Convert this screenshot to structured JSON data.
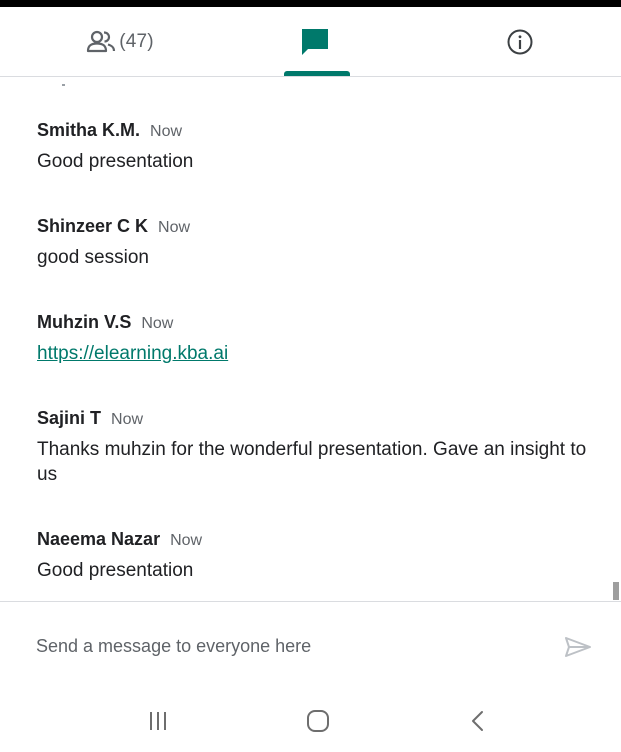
{
  "tabs": {
    "people_count": "(47)",
    "active": "chat"
  },
  "messages": [
    {
      "sender": "Smitha K.M.",
      "time": "Now",
      "text": "Good presentation",
      "is_link": false
    },
    {
      "sender": "Shinzeer C K",
      "time": "Now",
      "text": "good session",
      "is_link": false
    },
    {
      "sender": "Muhzin V.S",
      "time": "Now",
      "text": "https://elearning.kba.ai",
      "is_link": true
    },
    {
      "sender": "Sajini T",
      "time": "Now",
      "text": "Thanks muhzin for the wonderful presentation. Gave an insight to us",
      "is_link": false
    },
    {
      "sender": "Naeema Nazar",
      "time": "Now",
      "text": "Good presentation",
      "is_link": false
    }
  ],
  "composer": {
    "placeholder": "Send a message to everyone here",
    "value": ""
  },
  "icons": {
    "people": "people-icon",
    "chat": "chat-bubble-icon",
    "info": "info-icon",
    "send": "send-icon",
    "recents": "recents-icon",
    "home": "home-icon",
    "back": "back-icon"
  },
  "colors": {
    "accent": "#00796b",
    "link": "#00796b",
    "text_primary": "#202124",
    "text_secondary": "#5f6368",
    "send_disabled": "#bdc1c6"
  }
}
